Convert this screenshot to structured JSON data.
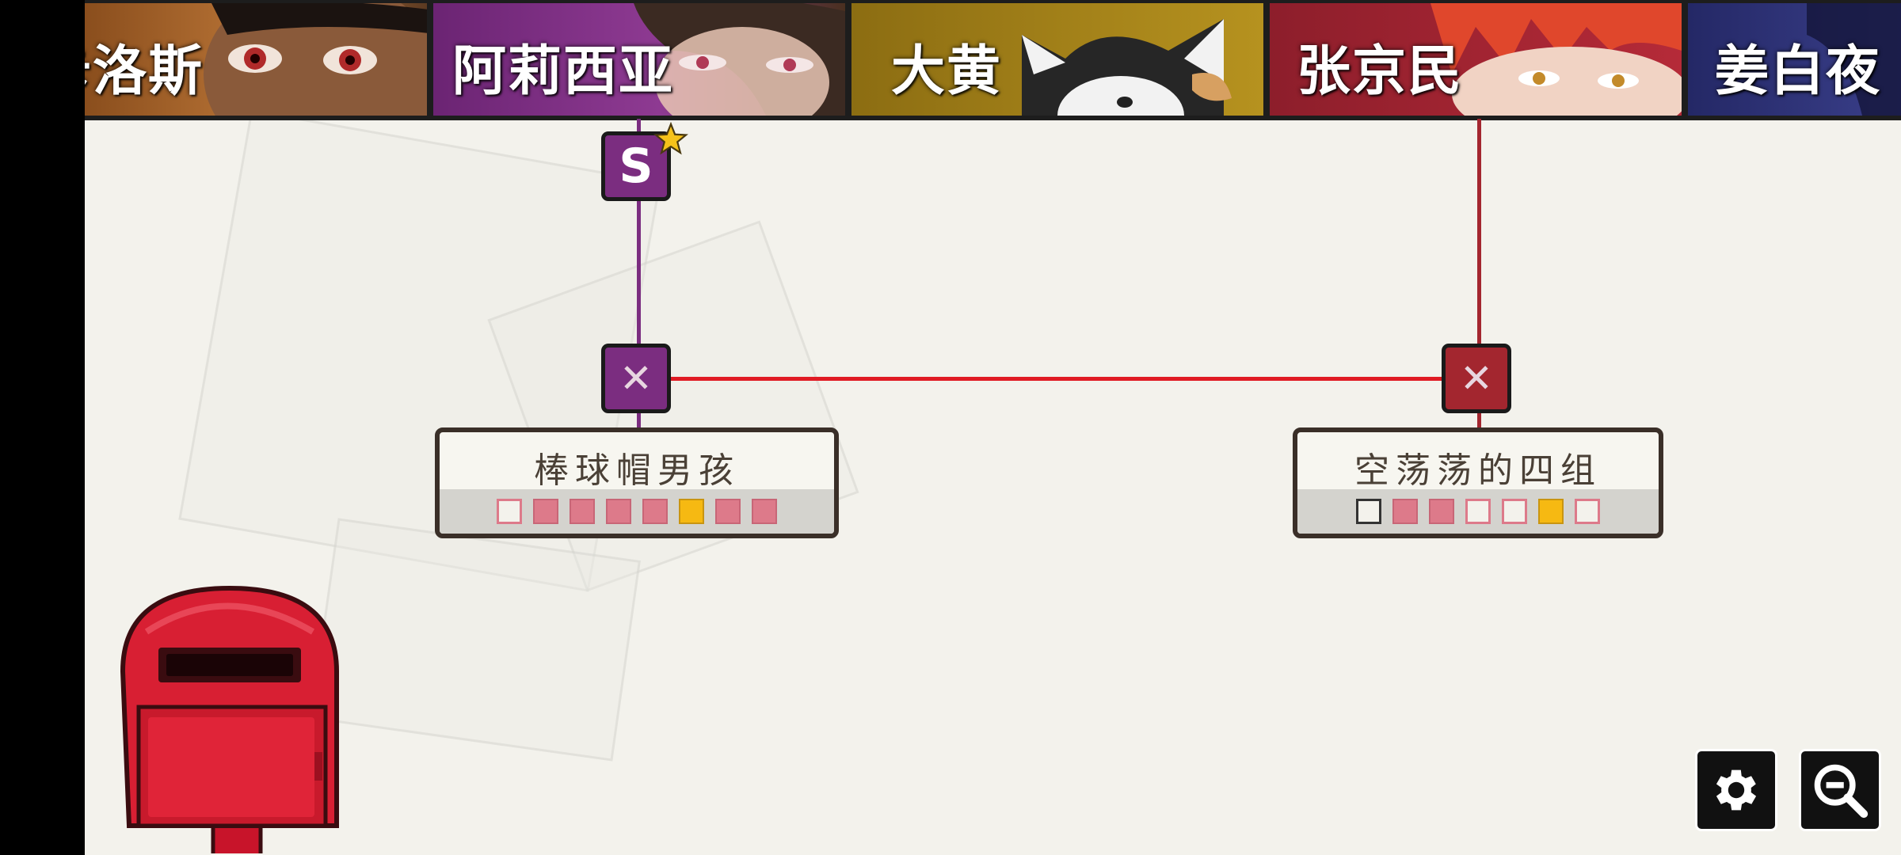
{
  "characters": [
    {
      "name": "卡洛斯",
      "bg": "#a8602a",
      "icon": "portrait-carlos"
    },
    {
      "name": "阿莉西亚",
      "bg": "#7a2f82",
      "icon": "portrait-alicia"
    },
    {
      "name": "大黄",
      "bg": "#a68419",
      "icon": "portrait-dahuang-cat"
    },
    {
      "name": "张京民",
      "bg": "#a82734",
      "icon": "portrait-zhang-jingmin"
    },
    {
      "name": "姜白夜",
      "bg": "#2b2f6e",
      "icon": "portrait-jiang-baiye"
    }
  ],
  "nodes": {
    "s_node": {
      "label": "S",
      "color": "#7b2d80",
      "badge": "star"
    },
    "alicia_x": {
      "label": "✕",
      "color": "#7b2d80"
    },
    "zhang_x": {
      "label": "✕",
      "color": "#a3262f"
    }
  },
  "cards": {
    "left": {
      "title": "棒球帽男孩",
      "squares": [
        "empty",
        "filled",
        "filled",
        "filled",
        "filled",
        "gold",
        "filled",
        "filled"
      ]
    },
    "right": {
      "title": "空荡荡的四组",
      "squares": [
        "dark",
        "filled",
        "filled",
        "empty",
        "empty",
        "gold",
        "empty"
      ]
    }
  },
  "colors": {
    "alicia_line": "#7b2d80",
    "zhang_line": "#a3262f",
    "connector": "#e01b24"
  },
  "controls": {
    "settings_icon": "gear-icon",
    "zoom_icon": "zoom-out-icon"
  }
}
